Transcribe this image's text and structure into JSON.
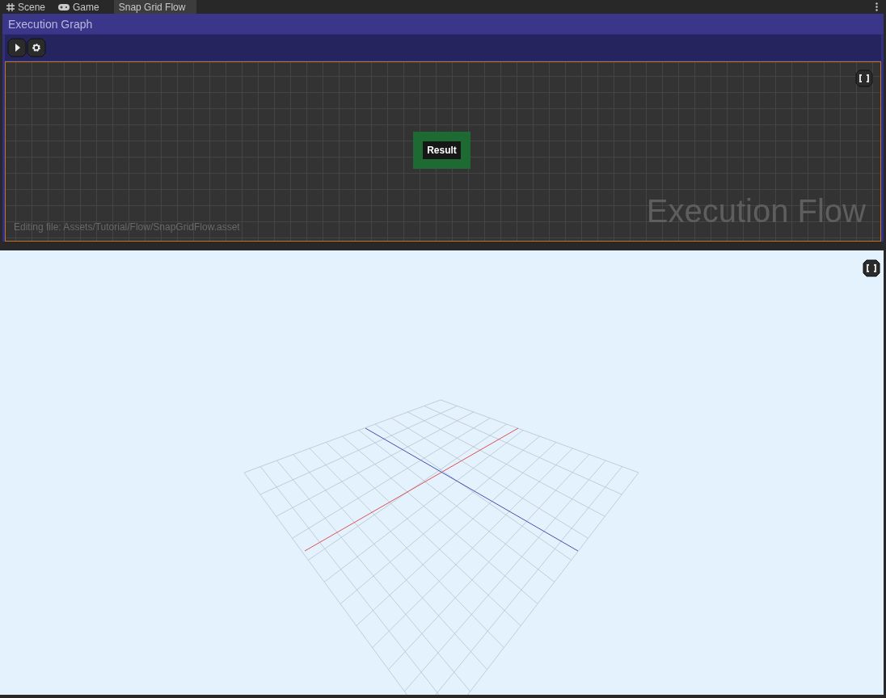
{
  "tabs": [
    {
      "label": "Scene",
      "kind": "scene",
      "selected": false
    },
    {
      "label": "Game",
      "kind": "game",
      "selected": false
    },
    {
      "label": "Snap Grid Flow",
      "kind": "graph",
      "selected": true
    }
  ],
  "graph_window": {
    "title": "Execution Graph",
    "nodes": [
      {
        "label": "Result"
      }
    ],
    "watermark": "Execution Flow",
    "footer": "Editing file: Assets/Tutorial/Flow/SnapGridFlow.asset"
  }
}
